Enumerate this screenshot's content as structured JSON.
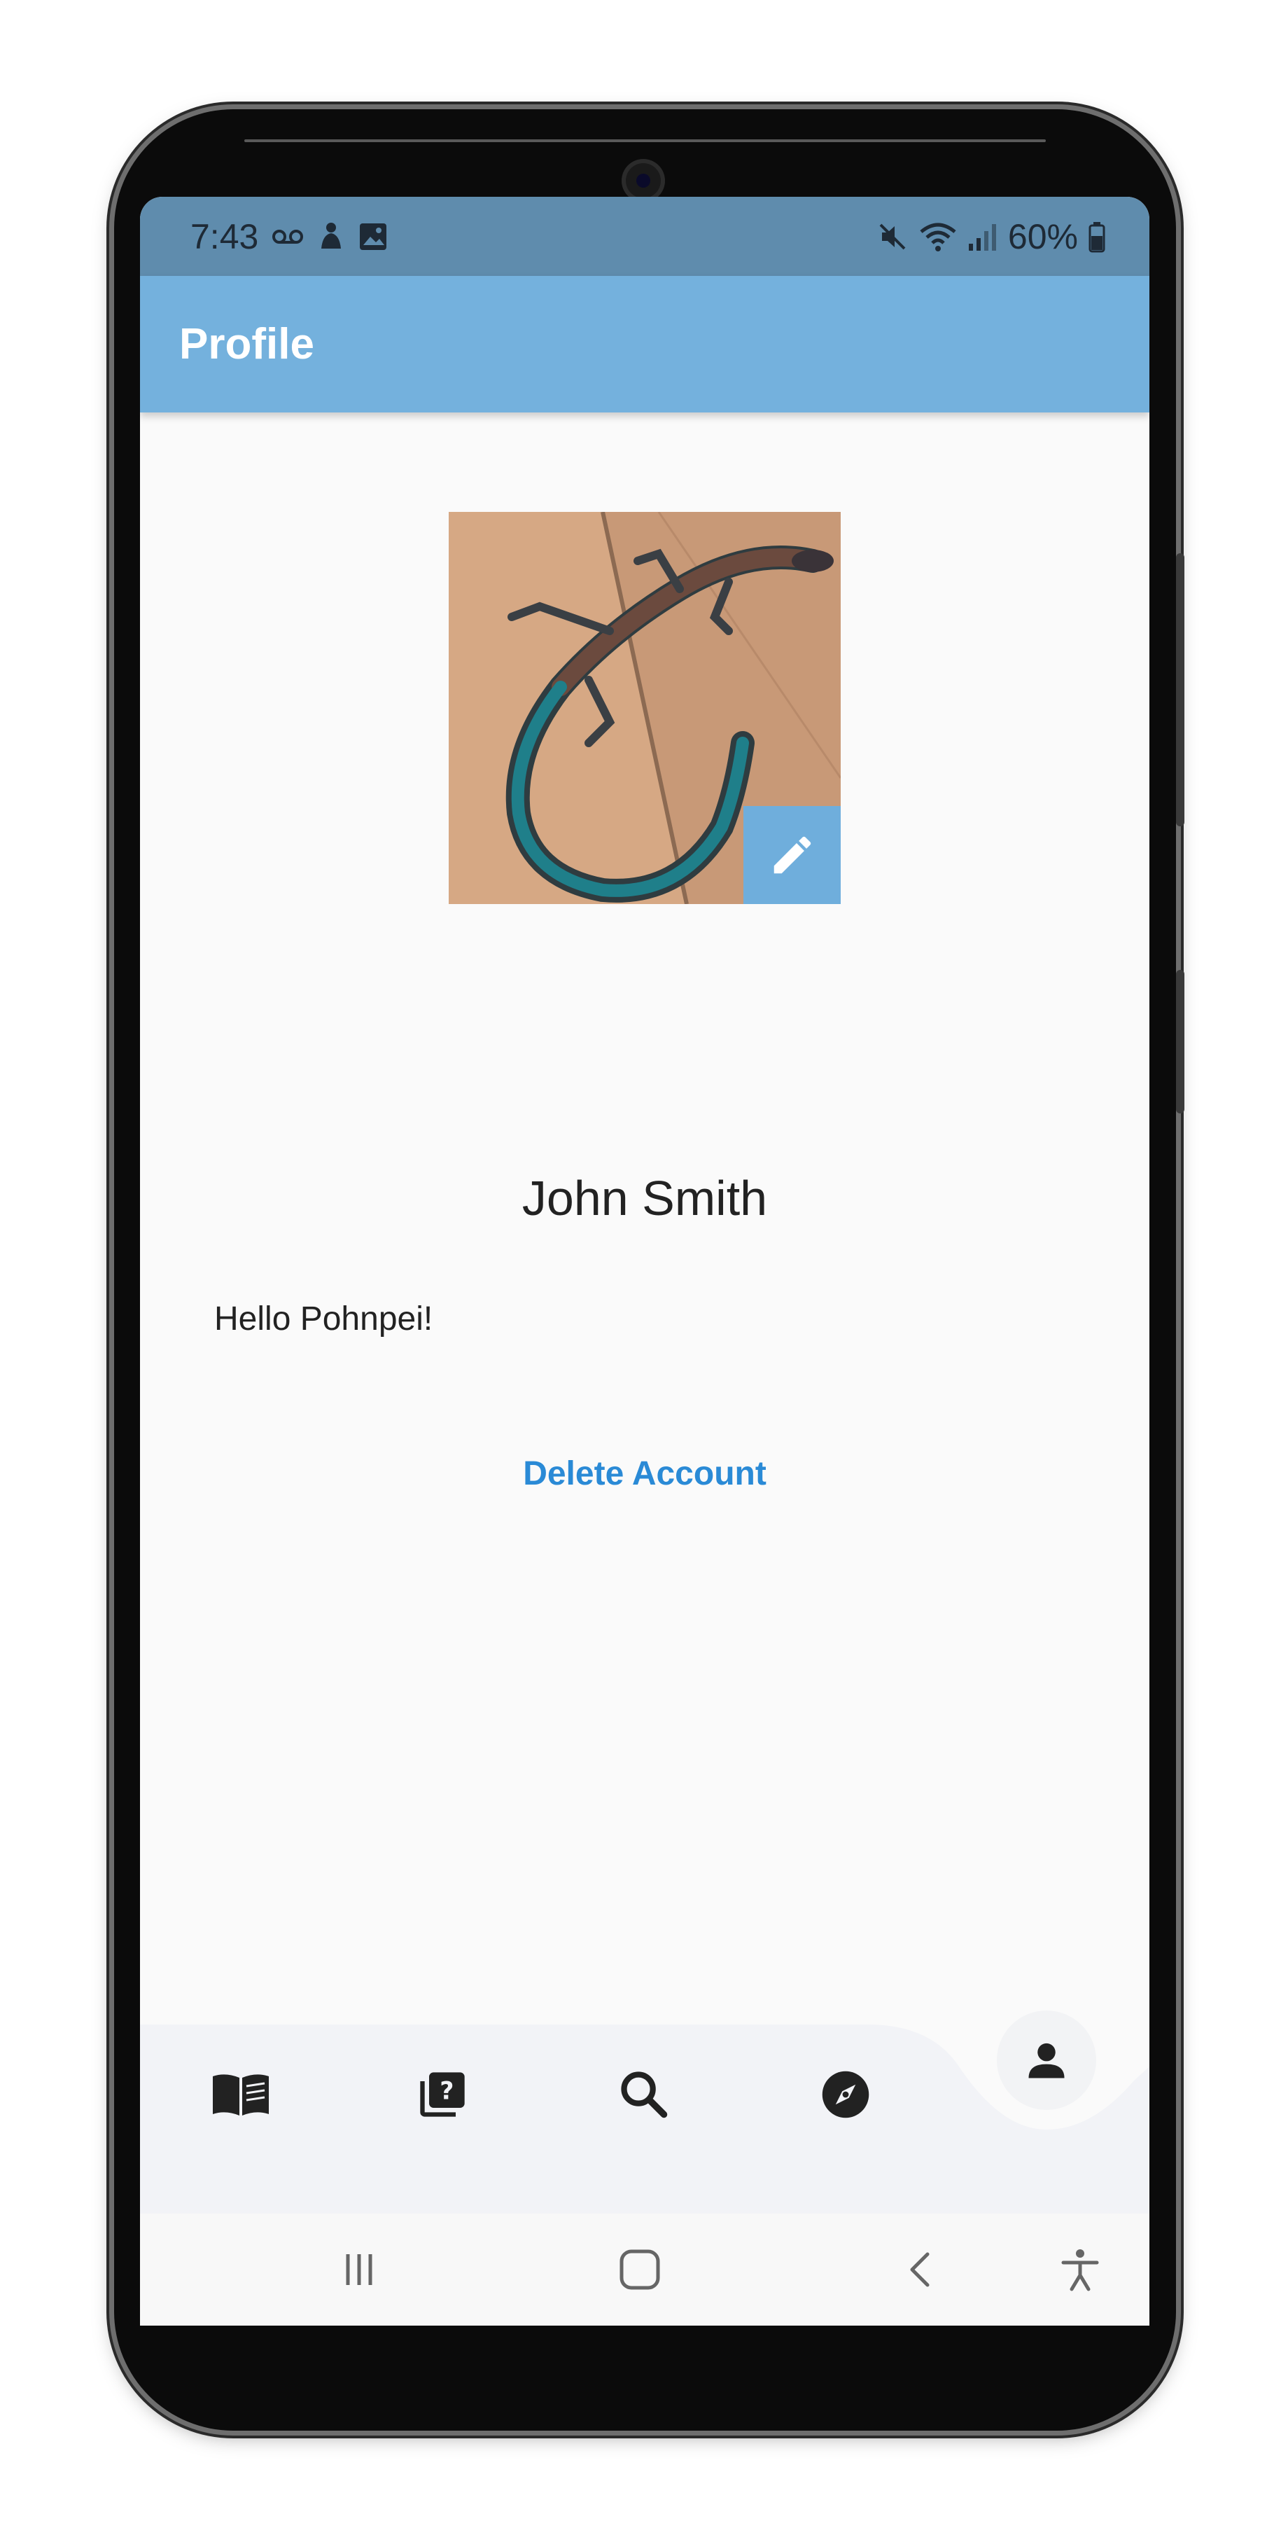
{
  "status_bar": {
    "time": "7:43",
    "battery": "60%",
    "left_icons": [
      "voicemail-icon",
      "notification-icon",
      "image-icon"
    ],
    "right_icons": [
      "mute-icon",
      "wifi-icon",
      "signal-icon",
      "battery-icon"
    ]
  },
  "app_bar": {
    "title": "Profile"
  },
  "profile": {
    "name": "John Smith",
    "bio": "Hello Pohnpei!",
    "delete_label": "Delete Account",
    "edit_icon": "pencil-icon",
    "avatar": "lizard-photo"
  },
  "bottom_nav": {
    "items": [
      "book-icon",
      "quiz-icon",
      "search-icon",
      "compass-icon",
      "person-icon"
    ],
    "active": "person-icon"
  },
  "system_nav": [
    "recents-icon",
    "home-icon",
    "back-icon",
    "accessibility-icon"
  ],
  "colors": {
    "status_bar": "#5f8cad",
    "app_bar": "#74b1dd",
    "accent": "#2a8ad6",
    "background": "#fafafa",
    "nav_background": "#f2f3f7"
  }
}
